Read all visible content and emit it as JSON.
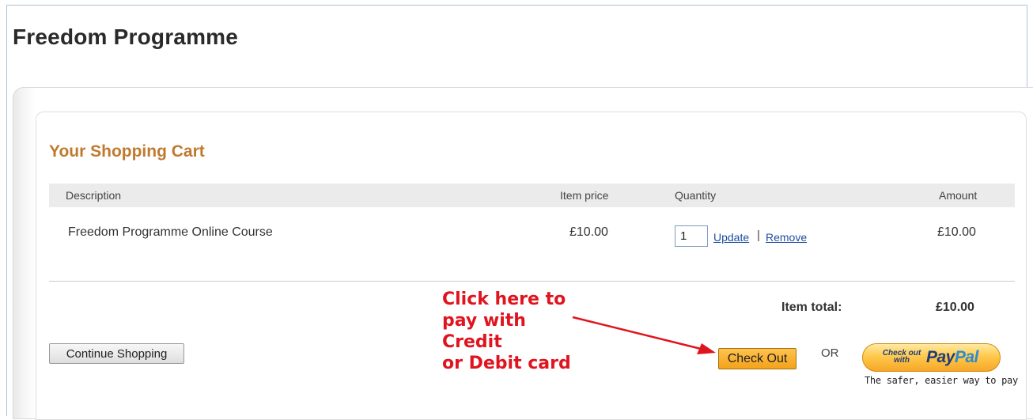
{
  "site": {
    "title": "Freedom Programme"
  },
  "cart": {
    "heading": "Your Shopping Cart",
    "columns": {
      "description": "Description",
      "item_price": "Item price",
      "quantity": "Quantity",
      "amount": "Amount"
    },
    "items": [
      {
        "description": "Freedom Programme Online Course",
        "item_price": "£10.00",
        "quantity": "1",
        "amount": "£10.00",
        "update_label": "Update",
        "separator": "|",
        "remove_label": "Remove"
      }
    ],
    "item_total_label": "Item total:",
    "item_total_value": "£10.00"
  },
  "actions": {
    "continue_label": "Continue Shopping",
    "checkout_label": "Check Out",
    "or_label": "OR",
    "paypal": {
      "small_label": "Check out with",
      "logo_pay": "Pay",
      "logo_pal": "Pal",
      "tagline": "The safer, easier way to pay"
    }
  },
  "annotation": {
    "lines": [
      "Click here to",
      "pay with",
      "Credit",
      "or Debit card"
    ],
    "color": "#e0141e"
  },
  "colors": {
    "heading": "#c07a2f",
    "link": "#1f4fa0",
    "checkout_button": "#f4a21a"
  }
}
